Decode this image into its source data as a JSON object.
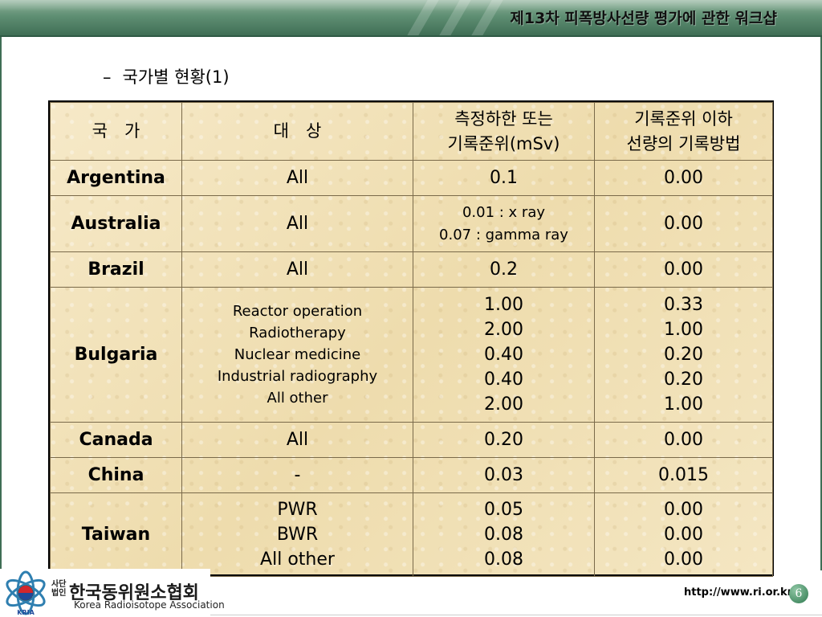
{
  "header": {
    "title": "제13차 피폭방사선량 평가에 관한 워크샵"
  },
  "subtitle": {
    "dash": "–",
    "text": "국가별 현황(1)"
  },
  "table": {
    "headers": [
      [
        "국　가"
      ],
      [
        "대　상"
      ],
      [
        "측정하한 또는",
        "기록준위(mSv)"
      ],
      [
        "기록준위 이하",
        "선량의 기록방법"
      ]
    ],
    "rows": [
      {
        "country": "Argentina",
        "target": [
          "All"
        ],
        "level": [
          "0.1"
        ],
        "method": [
          "0.00"
        ]
      },
      {
        "country": "Australia",
        "target": [
          "All"
        ],
        "level": [
          "0.01 : x ray",
          "0.07 : gamma ray"
        ],
        "method": [
          "0.00"
        ]
      },
      {
        "country": "Brazil",
        "target": [
          "All"
        ],
        "level": [
          "0.2"
        ],
        "method": [
          "0.00"
        ]
      },
      {
        "country": "Bulgaria",
        "target": [
          "Reactor operation",
          "Radiotherapy",
          "Nuclear medicine",
          "Industrial radiography",
          "All other"
        ],
        "level": [
          "1.00",
          "2.00",
          "0.40",
          "0.40",
          "2.00"
        ],
        "method": [
          "0.33",
          "1.00",
          "0.20",
          "0.20",
          "1.00"
        ]
      },
      {
        "country": "Canada",
        "target": [
          "All"
        ],
        "level": [
          "0.20"
        ],
        "method": [
          "0.00"
        ]
      },
      {
        "country": "China",
        "target": [
          "-"
        ],
        "level": [
          "0.03"
        ],
        "method": [
          "0.015"
        ]
      },
      {
        "country": "Taiwan",
        "target": [
          "PWR",
          "BWR",
          "All other"
        ],
        "level": [
          "0.05",
          "0.08",
          "0.08"
        ],
        "method": [
          "0.00",
          "0.00",
          "0.00"
        ]
      }
    ]
  },
  "footer": {
    "org_prefix": "사단 법인",
    "org_name_kr": "한국동위원소협회",
    "org_name_en": "Korea Radioisotope Association",
    "logo_text": "KRIA",
    "url": "http://www.ri.or.kr",
    "page_number": "6"
  },
  "colors": {
    "header": "#5f8f73",
    "table_bg": "#f2e2b8",
    "page_badge": "#2f7a50"
  }
}
